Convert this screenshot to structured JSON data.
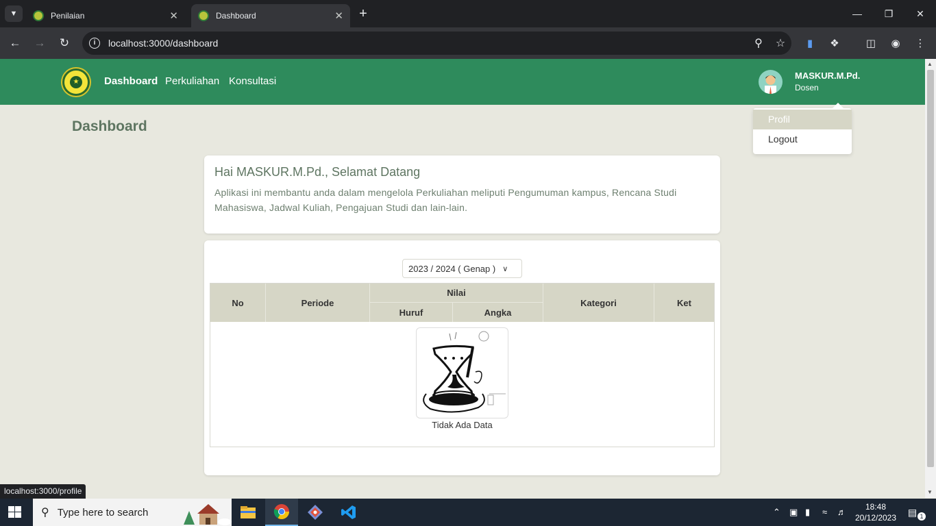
{
  "browser": {
    "tabs": [
      {
        "label": "Penilaian"
      },
      {
        "label": "Dashboard"
      }
    ],
    "url": "localhost:3000/dashboard",
    "status_url": "localhost:3000/profile"
  },
  "app": {
    "nav": {
      "links": [
        "Dashboard",
        "Perkuliahan",
        "Konsultasi"
      ],
      "user_name": "MASKUR.M.Pd.",
      "user_role": "Dosen"
    },
    "dropdown": [
      "Profil",
      "Logout"
    ],
    "page_title": "Dashboard",
    "welcome": {
      "title": "Hai MASKUR.M.Pd., Selamat Datang",
      "body": "Aplikasi ini membantu anda dalam mengelola Perkuliahan meliputi Pengumuman kampus, Rencana Studi Mahasiswa, Jadwal Kuliah, Pengajuan Studi dan lain-lain."
    },
    "period_select": "2023 / 2024 ( Genap )",
    "table": {
      "headers": {
        "no": "No",
        "periode": "Periode",
        "nilai": "Nilai",
        "huruf": "Huruf",
        "angka": "Angka",
        "kategori": "Kategori",
        "ket": "Ket"
      },
      "empty_text": "Tidak Ada Data"
    }
  },
  "taskbar": {
    "search_placeholder": "Type here to search",
    "time": "18:48",
    "date": "20/12/2023",
    "notification_count": "1"
  },
  "colors": {
    "nav_green": "#2e8b5c",
    "page_bg": "#e8e8df",
    "table_header": "#d6d6c6"
  }
}
